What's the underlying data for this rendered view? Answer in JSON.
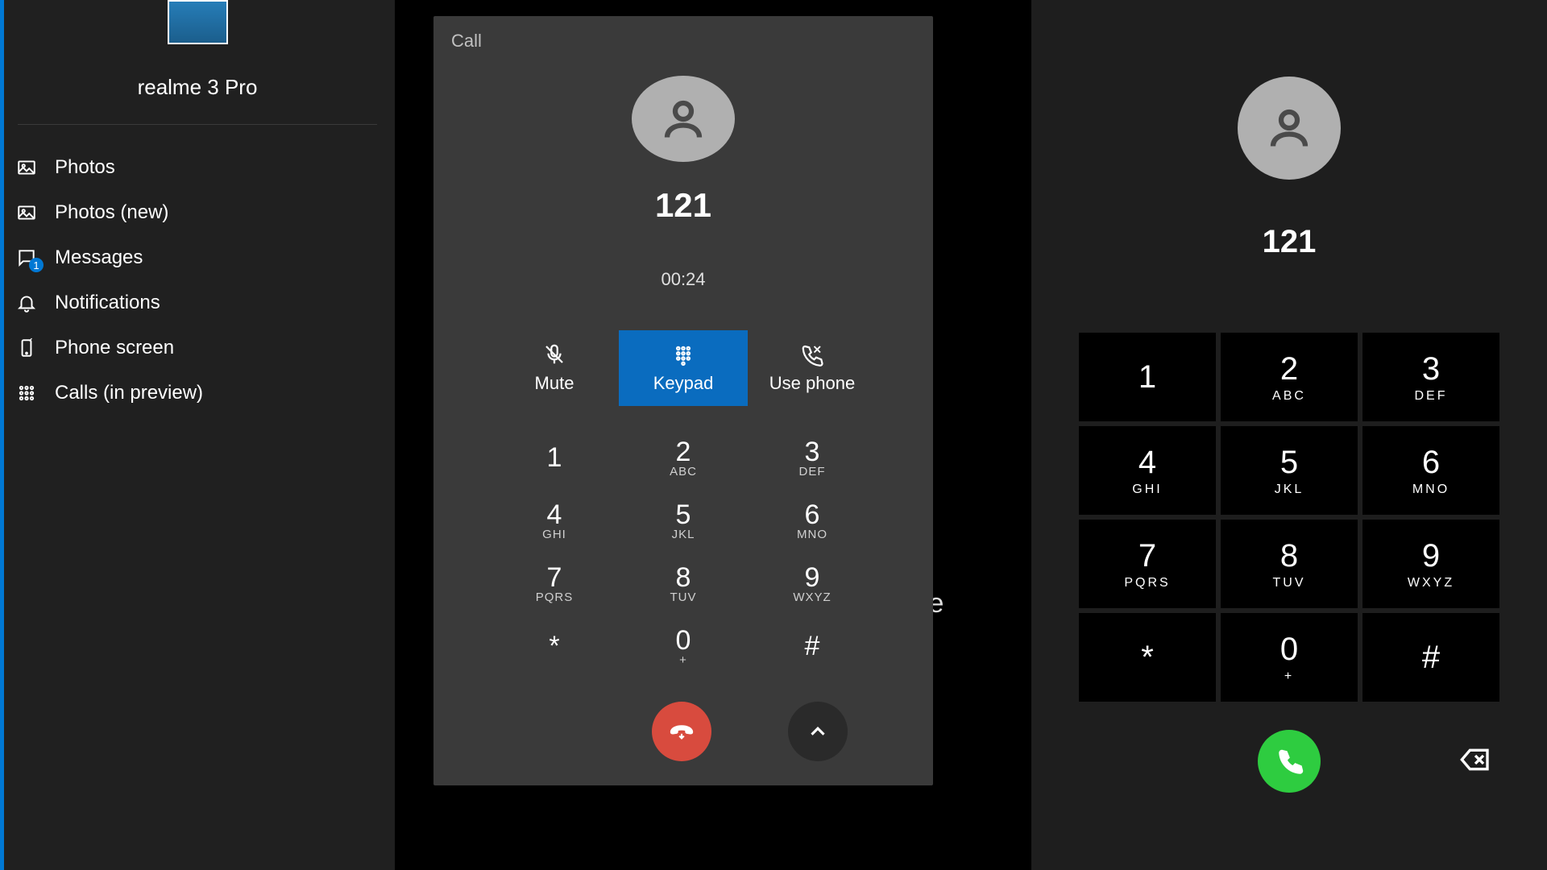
{
  "sidebar": {
    "device_name": "realme 3 Pro",
    "items": [
      {
        "label": "Photos"
      },
      {
        "label": "Photos (new)"
      },
      {
        "label": "Messages",
        "badge": "1"
      },
      {
        "label": "Notifications"
      },
      {
        "label": "Phone screen"
      },
      {
        "label": "Calls (in preview)"
      }
    ]
  },
  "call_panel": {
    "title": "Call",
    "number": "121",
    "time": "00:24",
    "actions": {
      "mute": "Mute",
      "keypad": "Keypad",
      "use_phone": "Use phone"
    },
    "keys": [
      {
        "d": "1",
        "l": ""
      },
      {
        "d": "2",
        "l": "ABC"
      },
      {
        "d": "3",
        "l": "DEF"
      },
      {
        "d": "4",
        "l": "GHI"
      },
      {
        "d": "5",
        "l": "JKL"
      },
      {
        "d": "6",
        "l": "MNO"
      },
      {
        "d": "7",
        "l": "PQRS"
      },
      {
        "d": "8",
        "l": "TUV"
      },
      {
        "d": "9",
        "l": "WXYZ"
      },
      {
        "d": "*",
        "l": ""
      },
      {
        "d": "0",
        "l": "+"
      },
      {
        "d": "#",
        "l": ""
      }
    ]
  },
  "background": {
    "partial_text": "te"
  },
  "dialer": {
    "number": "121",
    "keys": [
      {
        "d": "1",
        "l": ""
      },
      {
        "d": "2",
        "l": "ABC"
      },
      {
        "d": "3",
        "l": "DEF"
      },
      {
        "d": "4",
        "l": "GHI"
      },
      {
        "d": "5",
        "l": "JKL"
      },
      {
        "d": "6",
        "l": "MNO"
      },
      {
        "d": "7",
        "l": "PQRS"
      },
      {
        "d": "8",
        "l": "TUV"
      },
      {
        "d": "9",
        "l": "WXYZ"
      },
      {
        "d": "*",
        "l": ""
      },
      {
        "d": "0",
        "l": "+"
      },
      {
        "d": "#",
        "l": ""
      }
    ]
  }
}
